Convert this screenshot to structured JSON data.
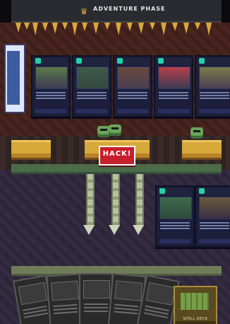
{
  "header": {
    "phase_title": "ADVENTURE PHASE",
    "emblem_icon": "crown-icon"
  },
  "sign": {
    "label": "HACK!"
  },
  "pile": {
    "label": "SPELL DECK"
  },
  "colors": {
    "gold": "#d7a93b",
    "card_border": "#0f1226",
    "alert": "#c81f2c"
  }
}
